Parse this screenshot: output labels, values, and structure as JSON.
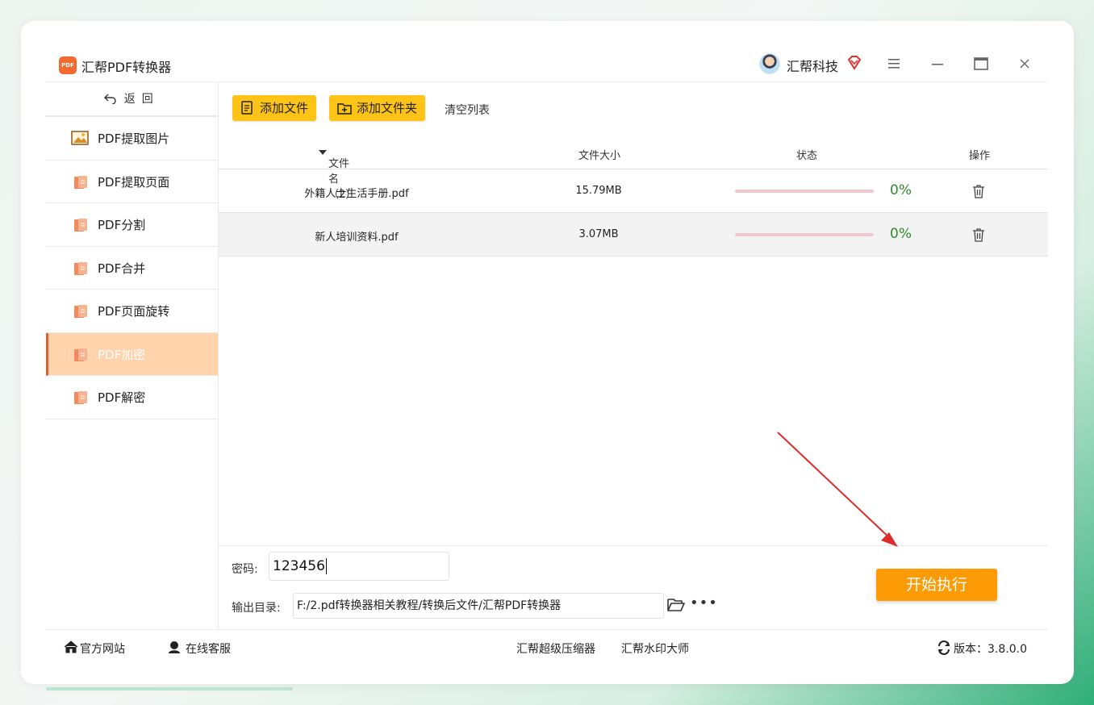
{
  "app": {
    "title": "汇帮PDF转换器",
    "logo_text": "PDF",
    "user_name": "汇帮科技"
  },
  "sidebar": {
    "back_label": "返回",
    "items": [
      {
        "label": "PDF提取图片",
        "icon": "image-icon"
      },
      {
        "label": "PDF提取页面",
        "icon": "pdf-doc-icon"
      },
      {
        "label": "PDF分割",
        "icon": "pdf-doc-icon"
      },
      {
        "label": "PDF合并",
        "icon": "pdf-doc-icon"
      },
      {
        "label": "PDF页面旋转",
        "icon": "pdf-doc-icon"
      },
      {
        "label": "PDF加密",
        "icon": "pdf-doc-icon",
        "active": true
      },
      {
        "label": "PDF解密",
        "icon": "pdf-doc-icon"
      }
    ]
  },
  "toolbar": {
    "add_file": "添加文件",
    "add_folder": "添加文件夹",
    "clear_list": "清空列表"
  },
  "table": {
    "headers": {
      "name": "文件名（2）",
      "size": "文件大小",
      "status": "状态",
      "action": "操作"
    },
    "rows": [
      {
        "name": "外籍人士生活手册.pdf",
        "size": "15.79MB",
        "progress": 0,
        "percent": "0%"
      },
      {
        "name": "新人培训资料.pdf",
        "size": "3.07MB",
        "progress": 0,
        "percent": "0%"
      }
    ]
  },
  "settings": {
    "password_label": "密码:",
    "password_value": "123456",
    "output_label": "输出目录:",
    "output_path": "F:/2.pdf转换器相关教程/转换后文件/汇帮PDF转换器",
    "more": "•••",
    "start_button": "开始执行"
  },
  "footer": {
    "website": "官方网站",
    "support": "在线客服",
    "compressor": "汇帮超级压缩器",
    "watermark": "汇帮水印大师",
    "version": "版本：3.8.0.0"
  },
  "colors": {
    "accent_orange": "#fd9b07",
    "toolbar_yellow": "#fdc317",
    "active_item_bg": "#ffd3ac",
    "active_item_border": "#ea5b2c",
    "percent_green": "#2e8b2e",
    "annotation_arrow": "#e02b2b"
  }
}
